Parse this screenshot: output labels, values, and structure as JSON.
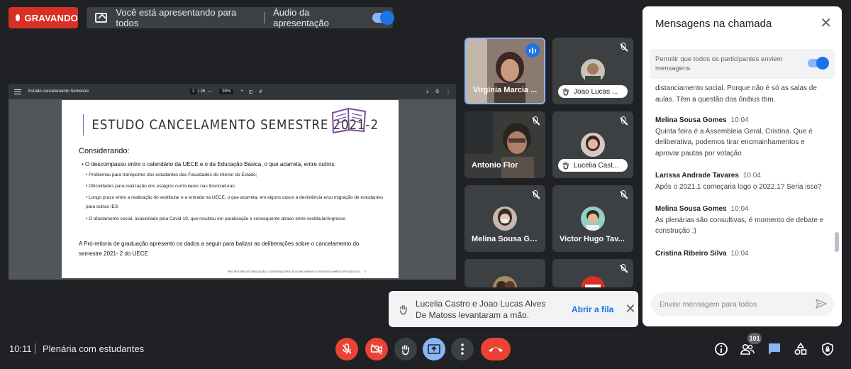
{
  "top_bar": {
    "recording_label": "GRAVANDO",
    "presenting_text": "Você está apresentando para todos",
    "audio_label": "Áudio da apresentação",
    "audio_toggle_on": true
  },
  "pdf_viewer": {
    "title": "Estudo cancelamento Semestre",
    "page_current": "2",
    "page_total": "/ 26",
    "zoom": "90%"
  },
  "slide": {
    "title": "ESTUDO CANCELAMENTO SEMESTRE 2021-2",
    "considerando": "Considerando:",
    "bullet_main": "• O descompasso entre o calendário da UECE e o da Educação Básica, o que acarreta, entre outros:",
    "sub_bullets": [
      "• Problemas para transportes dos estudantes das Faculdades do interior do Estado;",
      "• Dificuldades para realização dos estágios curriculares nas licenciaturas;",
      "• Longo prazo entre a realização do vestibular e a entrada na UECE, o que acarreta, em alguns casos a desistência e/ou migração de estudantes para outras IES;",
      "• O afastamento social, ocasionado pela Covid-19, que resultou em paralisação e consequente atraso entre vestibular/ingresso"
    ],
    "paragraph": "A Pró-reitoria de graduação apresento os dados a seguir para balizar as deliberações sobre o cancelamento do semestre  2021- 2 do UECE",
    "footer": "PRÓ-REITORIA DE GRADUAÇÃO | COORDENADORIA DE PLANEJAMENTO E DESENVOLVIMENTO PEDAGÓGICO",
    "footer_page": "3"
  },
  "participants": [
    {
      "name": "Virgínia Marcia ...",
      "state": "speaking"
    },
    {
      "name": "Joao Lucas ...",
      "state": "hand-raised-muted"
    },
    {
      "name": "Antonio Flor",
      "state": "muted"
    },
    {
      "name": "Lucelia Cast...",
      "state": "hand-raised-muted"
    },
    {
      "name": "Melina Sousa Go...",
      "state": "muted"
    },
    {
      "name": "Victor Hugo Tav...",
      "state": "muted"
    },
    {
      "name": "",
      "state": "muted"
    },
    {
      "name": "",
      "state": "muted"
    }
  ],
  "hand_popup": {
    "text": "Lucelia Castro e Joao Lucas Alves De Matoss levantaram a mão.",
    "link": "Abrir a fila"
  },
  "chat": {
    "title": "Mensagens na chamada",
    "permission_text": "Permitir que todos os participantes enviem mensagens",
    "permission_on": true,
    "partial_message": "distanciamento social. Porque não é só as salas de aulas. Têm a questão dos ônibus tbm.",
    "messages": [
      {
        "sender": "Melina Sousa Gomes",
        "time": "10:04",
        "text": "Quinta feira é a Assembleia Geral, Cristina. Que é deliberativa, podemos tirar encmainhamentos e aprovar pautas por votação"
      },
      {
        "sender": "Larissa Andrade Tavares",
        "time": "10:04",
        "text": "Após o 2021.1 começaria logo o 2022.1? Seria isso?"
      },
      {
        "sender": "Melina Sousa Gomes",
        "time": "10:04",
        "text": "As plenárias são consultivas, é momento de debate e construção :)"
      },
      {
        "sender": "Cristina Ribeiro Silva",
        "time": "10:04",
        "text": ""
      }
    ],
    "input_placeholder": "Enviar mensagem para todos"
  },
  "bottom_bar": {
    "time": "10:11",
    "meeting_name": "Plenária com estudantes",
    "participants_count": "101"
  },
  "colors": {
    "background": "#202124",
    "record_red": "#d93025",
    "accent_blue": "#1a73e8",
    "end_call_red": "#ea4335"
  }
}
